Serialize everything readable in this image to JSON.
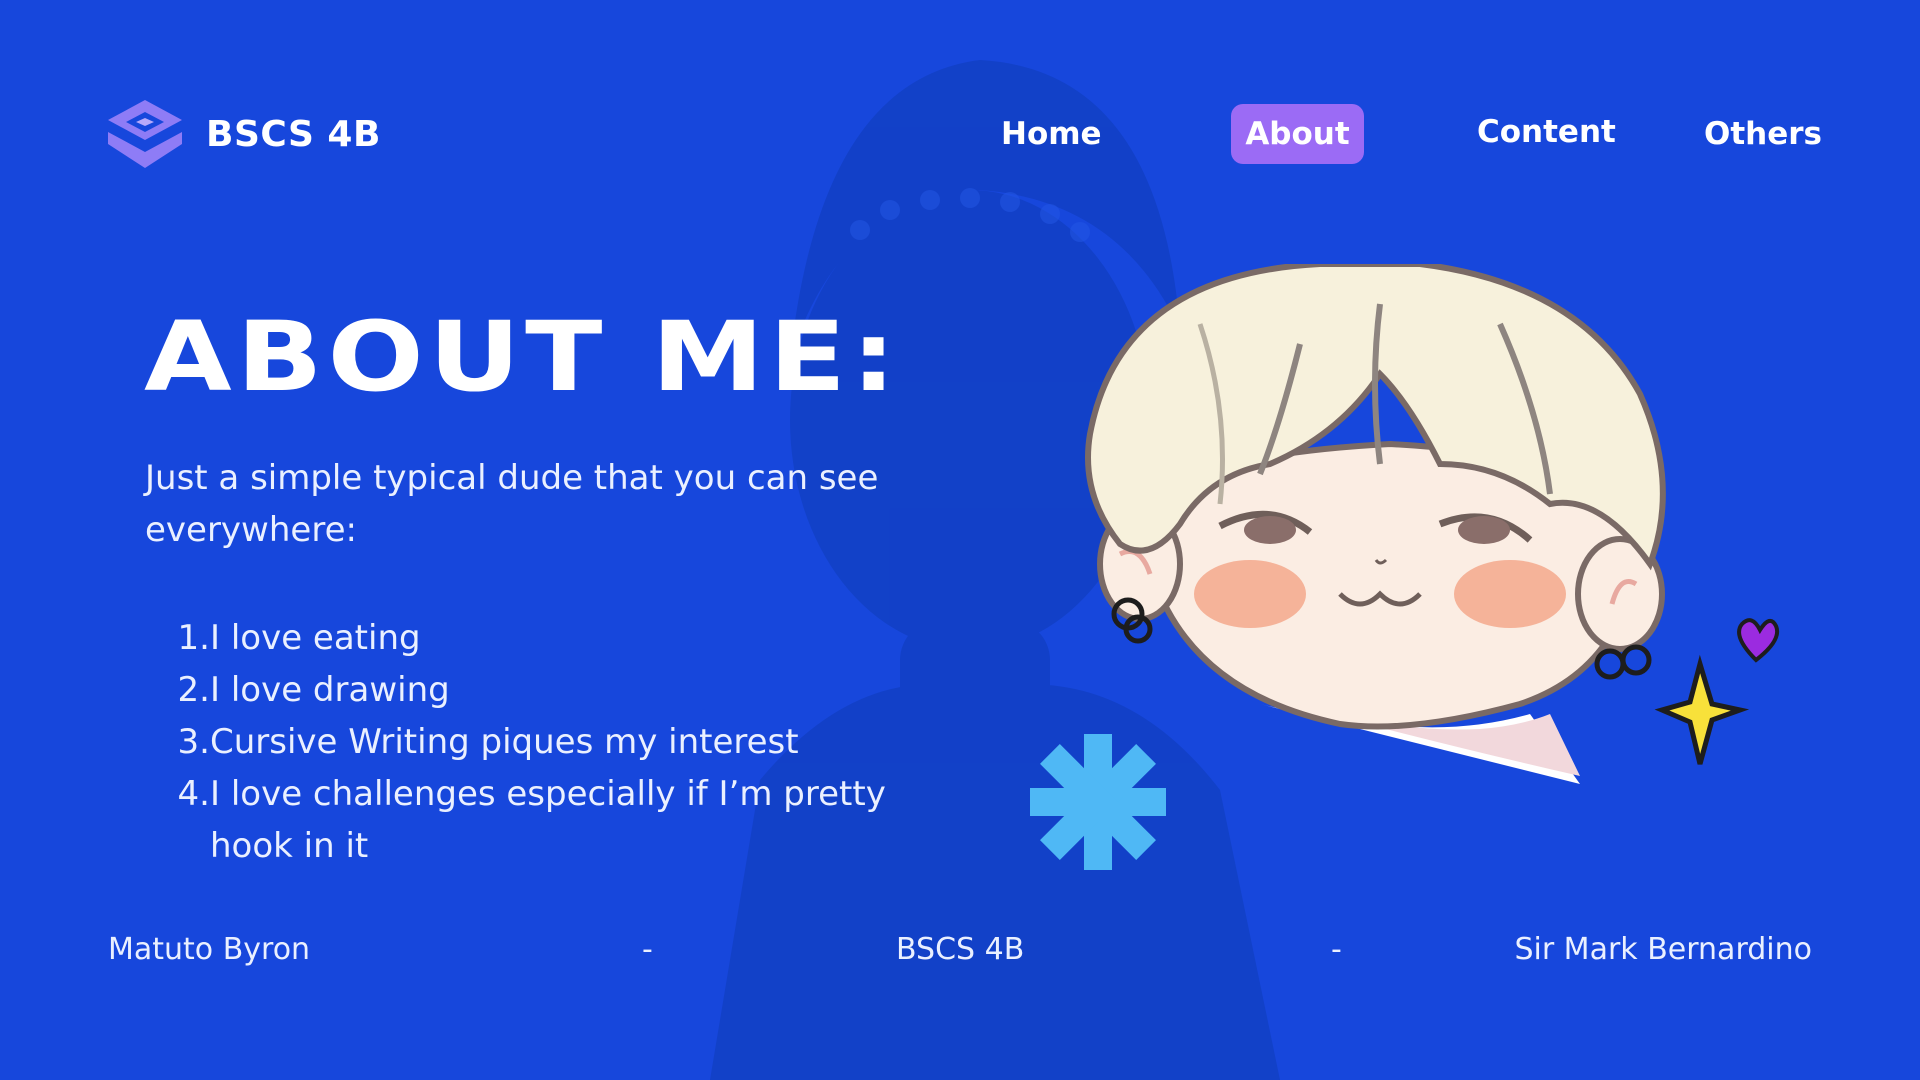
{
  "brand": {
    "name": "BSCS 4B",
    "logo_icon": "stacked-diamond-logo-icon"
  },
  "nav": {
    "items": [
      {
        "label": "Home",
        "active": false
      },
      {
        "label": "About",
        "active": true
      },
      {
        "label": "Content",
        "active": false
      },
      {
        "label": "Others",
        "active": false
      }
    ]
  },
  "main": {
    "title": "ABOUT ME:",
    "intro": "Just a simple typical dude that you can see everywhere:",
    "list": [
      {
        "num": "1.",
        "text": "I love eating"
      },
      {
        "num": "2.",
        "text": "I love drawing"
      },
      {
        "num": "3.",
        "text": "Cursive Writing piques my interest"
      },
      {
        "num": "4.",
        "text": "I love challenges especially if I’m pretty hook in it"
      }
    ]
  },
  "decor": {
    "avatar": "chibi-boy-avatar-illustration",
    "asterisk_icon": "asterisk-icon"
  },
  "footer": {
    "name": "Matuto Byron",
    "separator_1": "-",
    "class": "BSCS 4B",
    "separator_2": "-",
    "teacher": "Sir Mark Bernardino"
  },
  "colors": {
    "background": "#1747DC",
    "accent": "#9B6BF5",
    "asterisk": "#4FB8F5",
    "text": "#FFFFFF"
  }
}
